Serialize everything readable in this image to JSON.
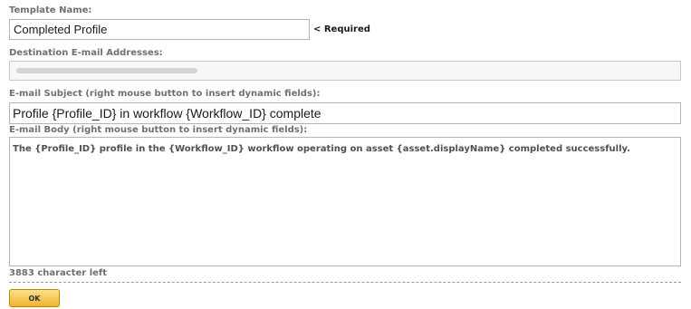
{
  "template_name": {
    "label": "Template Name:",
    "value": "Completed Profile",
    "required_note": "< Required"
  },
  "destination_email": {
    "label": "Destination E-mail Addresses:"
  },
  "email_subject": {
    "label": "E-mail Subject (right mouse button to insert dynamic fields):",
    "value": "Profile {Profile_ID} in workflow {Workflow_ID} complete"
  },
  "email_body": {
    "label": "E-mail Body (right mouse button to insert dynamic fields):",
    "value": "The {Profile_ID} profile in the {Workflow_ID} workflow operating on asset {asset.displayName} completed successfully."
  },
  "characters_left": "3883 character left",
  "ok_button": "OK",
  "colors": {
    "label_gray": "#707070",
    "field_border": "#b5b5b5",
    "ok_button_top": "#fbe18e",
    "ok_button_bottom": "#f1b42e"
  }
}
